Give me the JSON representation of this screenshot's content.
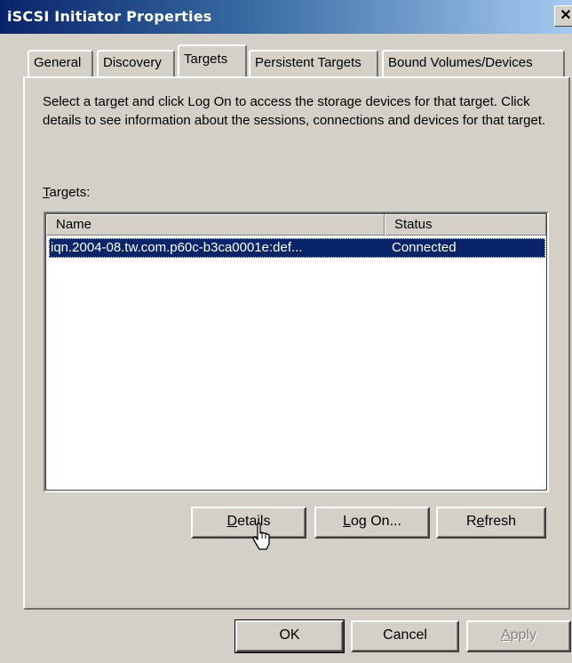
{
  "window": {
    "title": "iSCSI Initiator Properties",
    "close_glyph": "✕"
  },
  "tabs": [
    {
      "label": "General",
      "active": false
    },
    {
      "label": "Discovery",
      "active": false
    },
    {
      "label": "Targets",
      "active": true
    },
    {
      "label": "Persistent Targets",
      "active": false
    },
    {
      "label": "Bound Volumes/Devices",
      "active": false
    }
  ],
  "description": "Select a target and click Log On to access the storage devices for that target. Click details to see information about the sessions, connections and devices for that target.",
  "targets_label": "Targets:",
  "targets_list": {
    "columns": [
      "Name",
      "Status"
    ],
    "rows": [
      {
        "name": "iqn.2004-08.tw.com.p60c-b3ca0001e:def...",
        "status": "Connected",
        "selected": true
      }
    ]
  },
  "buttons": {
    "details": "Details",
    "log_on": "Log On...",
    "refresh": "Refresh",
    "ok": "OK",
    "cancel": "Cancel",
    "apply": "Apply"
  },
  "icons": {
    "close": "close-icon",
    "cursor": "hand-pointer-cursor-icon"
  },
  "colors": {
    "title_bar_start": "#0a246a",
    "title_bar_end": "#a6caf0",
    "dialog_face": "#d4d0c8",
    "selection": "#0a246a"
  }
}
